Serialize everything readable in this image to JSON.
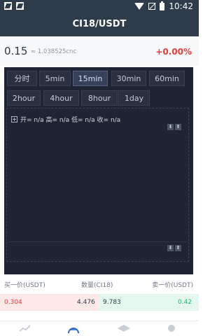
{
  "status_bar": {
    "time": "10:42"
  },
  "header": {
    "title": "CI18/USDT"
  },
  "price": {
    "last": "0.15",
    "approx": "≈ 1.038525cnc",
    "change": "+0.00%"
  },
  "timeframes": [
    {
      "label": "分时",
      "active": false
    },
    {
      "label": "5min",
      "active": false
    },
    {
      "label": "15min",
      "active": true
    },
    {
      "label": "30min",
      "active": false
    },
    {
      "label": "60min",
      "active": false
    },
    {
      "label": "2hour",
      "active": false
    },
    {
      "label": "4hour",
      "active": false
    },
    {
      "label": "8hour",
      "active": false
    },
    {
      "label": "1day",
      "active": false
    }
  ],
  "chart": {
    "ohlc_text": "开= n/a 高= n/a 低= n/a 收= n/a"
  },
  "orderbook": {
    "bid_header": "买一价(USDT)",
    "qty_header": "数量(CI18)",
    "ask_header": "卖一价(USDT)",
    "bid_price": "0.304",
    "bid_qty": "4.476",
    "ask_qty": "9.783",
    "ask_price": "0.42"
  },
  "colors": {
    "up": "#e63c3c",
    "down": "#22b573",
    "header_bg": "#2d3b4a",
    "panel_bg": "#1f2433"
  },
  "icons": [
    "chart-line-icon",
    "trade-icon",
    "stack-icon",
    "profile-icon"
  ]
}
